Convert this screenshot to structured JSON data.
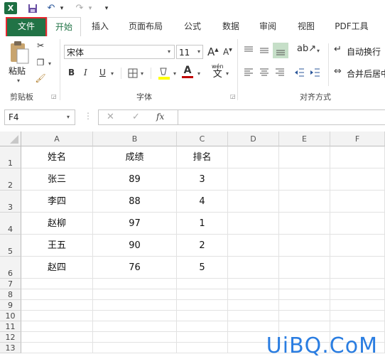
{
  "qat": {
    "logo": "X",
    "save_icon": "save-icon",
    "undo": "↶",
    "redo": "↷",
    "more": "▾"
  },
  "tabs": [
    {
      "label": "文件"
    },
    {
      "label": "开始"
    },
    {
      "label": "插入"
    },
    {
      "label": "页面布局"
    },
    {
      "label": "公式"
    },
    {
      "label": "数据"
    },
    {
      "label": "审阅"
    },
    {
      "label": "视图"
    },
    {
      "label": "PDF工具"
    }
  ],
  "ribbon": {
    "paste_label": "粘贴",
    "clipboard_group": "剪贴板",
    "font_name": "宋体",
    "font_size": "11",
    "grow_font": "A",
    "shrink_font": "A",
    "bold": "B",
    "italic": "I",
    "underline": "U",
    "wen": "wén",
    "wen_char": "文",
    "font_group": "字体",
    "wrap_text": "自动换行",
    "merge_center": "合并后居中",
    "align_group": "对齐方式"
  },
  "formula": {
    "cell_ref": "F4",
    "cancel": "✕",
    "enter": "✓",
    "fx": "fx",
    "value": ""
  },
  "columns": [
    "A",
    "B",
    "C",
    "D",
    "E",
    "F"
  ],
  "rows": [
    "1",
    "2",
    "3",
    "4",
    "5",
    "6",
    "7",
    "8",
    "9",
    "10",
    "11",
    "12",
    "13"
  ],
  "table": [
    [
      "姓名",
      "成绩",
      "排名"
    ],
    [
      "张三",
      "89",
      "3"
    ],
    [
      "李四",
      "88",
      "4"
    ],
    [
      "赵柳",
      "97",
      "1"
    ],
    [
      "王五",
      "90",
      "2"
    ],
    [
      "赵四",
      "76",
      "5"
    ]
  ],
  "watermark": "UiBQ.CoM",
  "colors": {
    "excel_green": "#217346",
    "highlight_red": "#e8262f",
    "font_color_red": "#c00000",
    "fill_yellow": "#ffff00"
  }
}
